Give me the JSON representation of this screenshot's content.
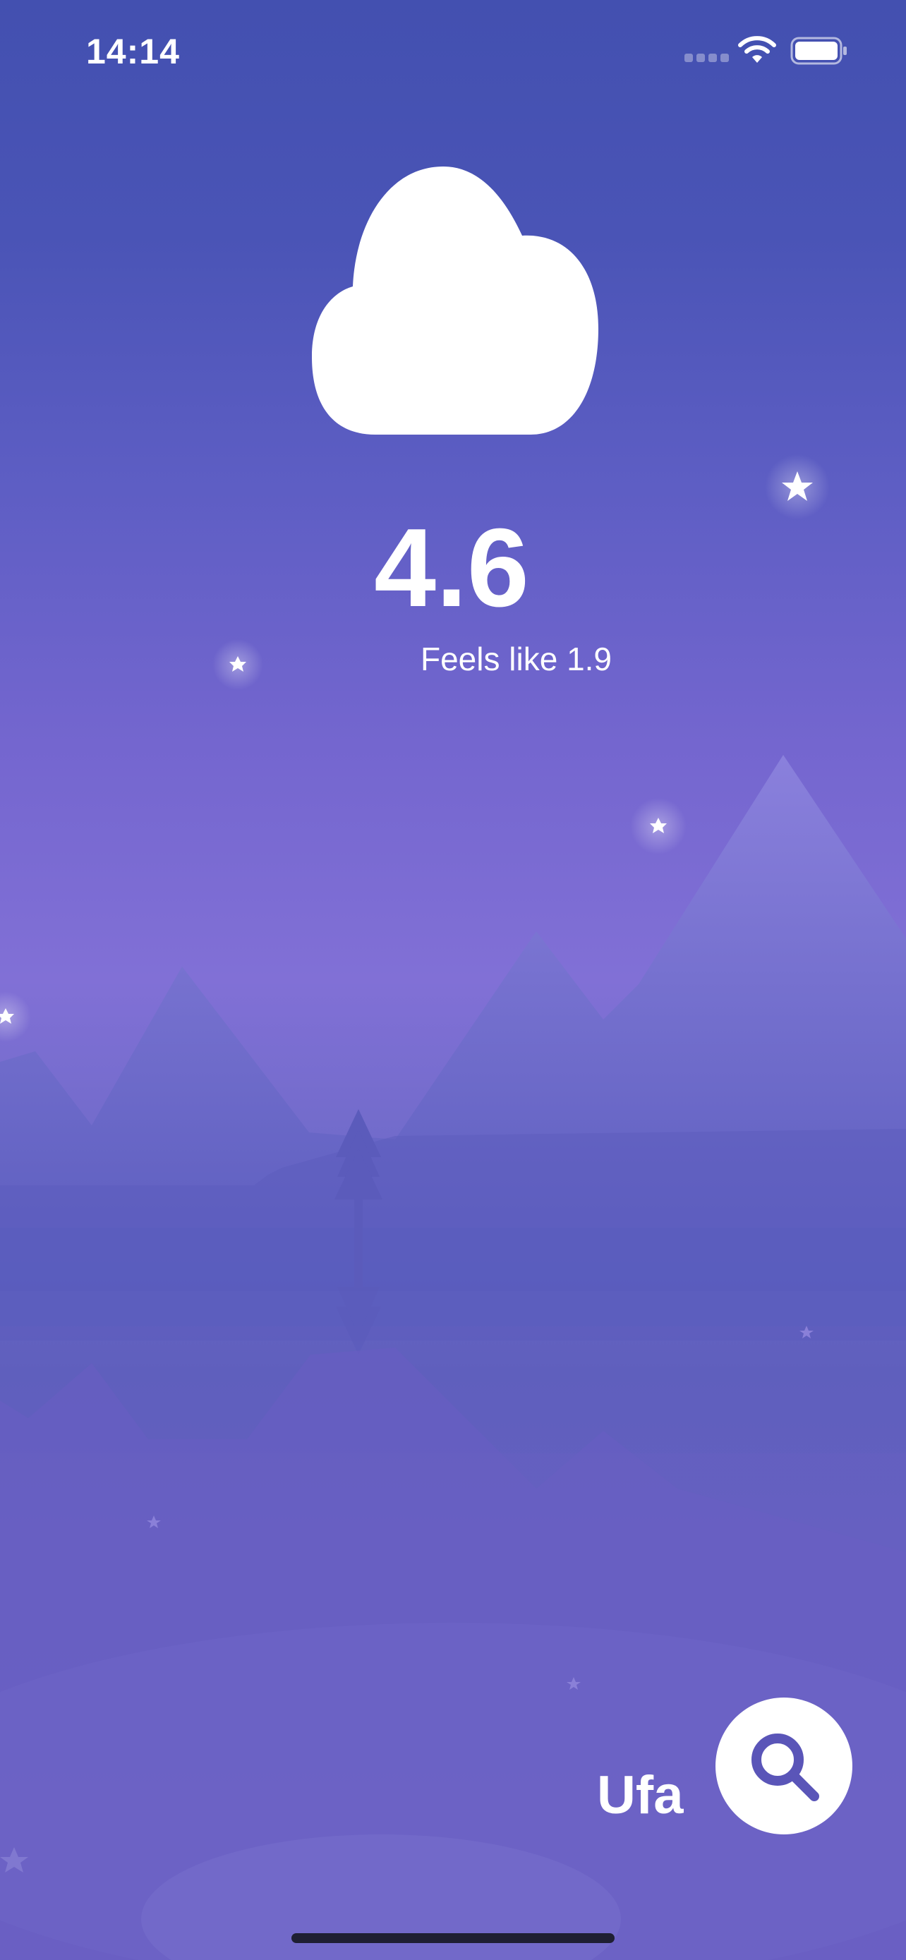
{
  "status_bar": {
    "time": "14:14",
    "icons": [
      "cellular-signal-icon",
      "wifi-icon",
      "battery-icon"
    ]
  },
  "weather": {
    "condition_icon": "cloud-icon",
    "temperature": "4.6",
    "feels_like": "Feels like 1.9"
  },
  "location": {
    "city": "Ufa"
  },
  "actions": {
    "search_icon": "search-icon"
  },
  "colors": {
    "sky_top": "#4350b0",
    "sky_mid": "#8170d6",
    "ground": "#6d62c6",
    "text": "#ffffff",
    "button_bg": "#ffffff",
    "search_icon": "#5a55b8"
  }
}
